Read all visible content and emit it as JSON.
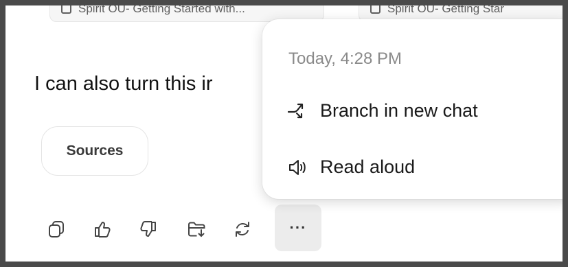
{
  "sources_chips": [
    {
      "title": "Spirit OU- Getting Started with..."
    },
    {
      "title": "Spirit OU- Getting Star"
    }
  ],
  "message": {
    "visible_text": "I can also turn this ir"
  },
  "sources_button": {
    "label": "Sources"
  },
  "actions": [
    {
      "icon": "copy-icon"
    },
    {
      "icon": "thumbs-up-icon"
    },
    {
      "icon": "thumbs-down-icon"
    },
    {
      "icon": "save-to-folder-icon"
    },
    {
      "icon": "regenerate-icon"
    },
    {
      "icon": "more-icon",
      "label": "···"
    }
  ],
  "context_menu": {
    "timestamp": "Today, 4:28 PM",
    "items": [
      {
        "label": "Branch in new chat",
        "icon": "branch-icon"
      },
      {
        "label": "Read aloud",
        "icon": "speaker-icon"
      }
    ]
  }
}
